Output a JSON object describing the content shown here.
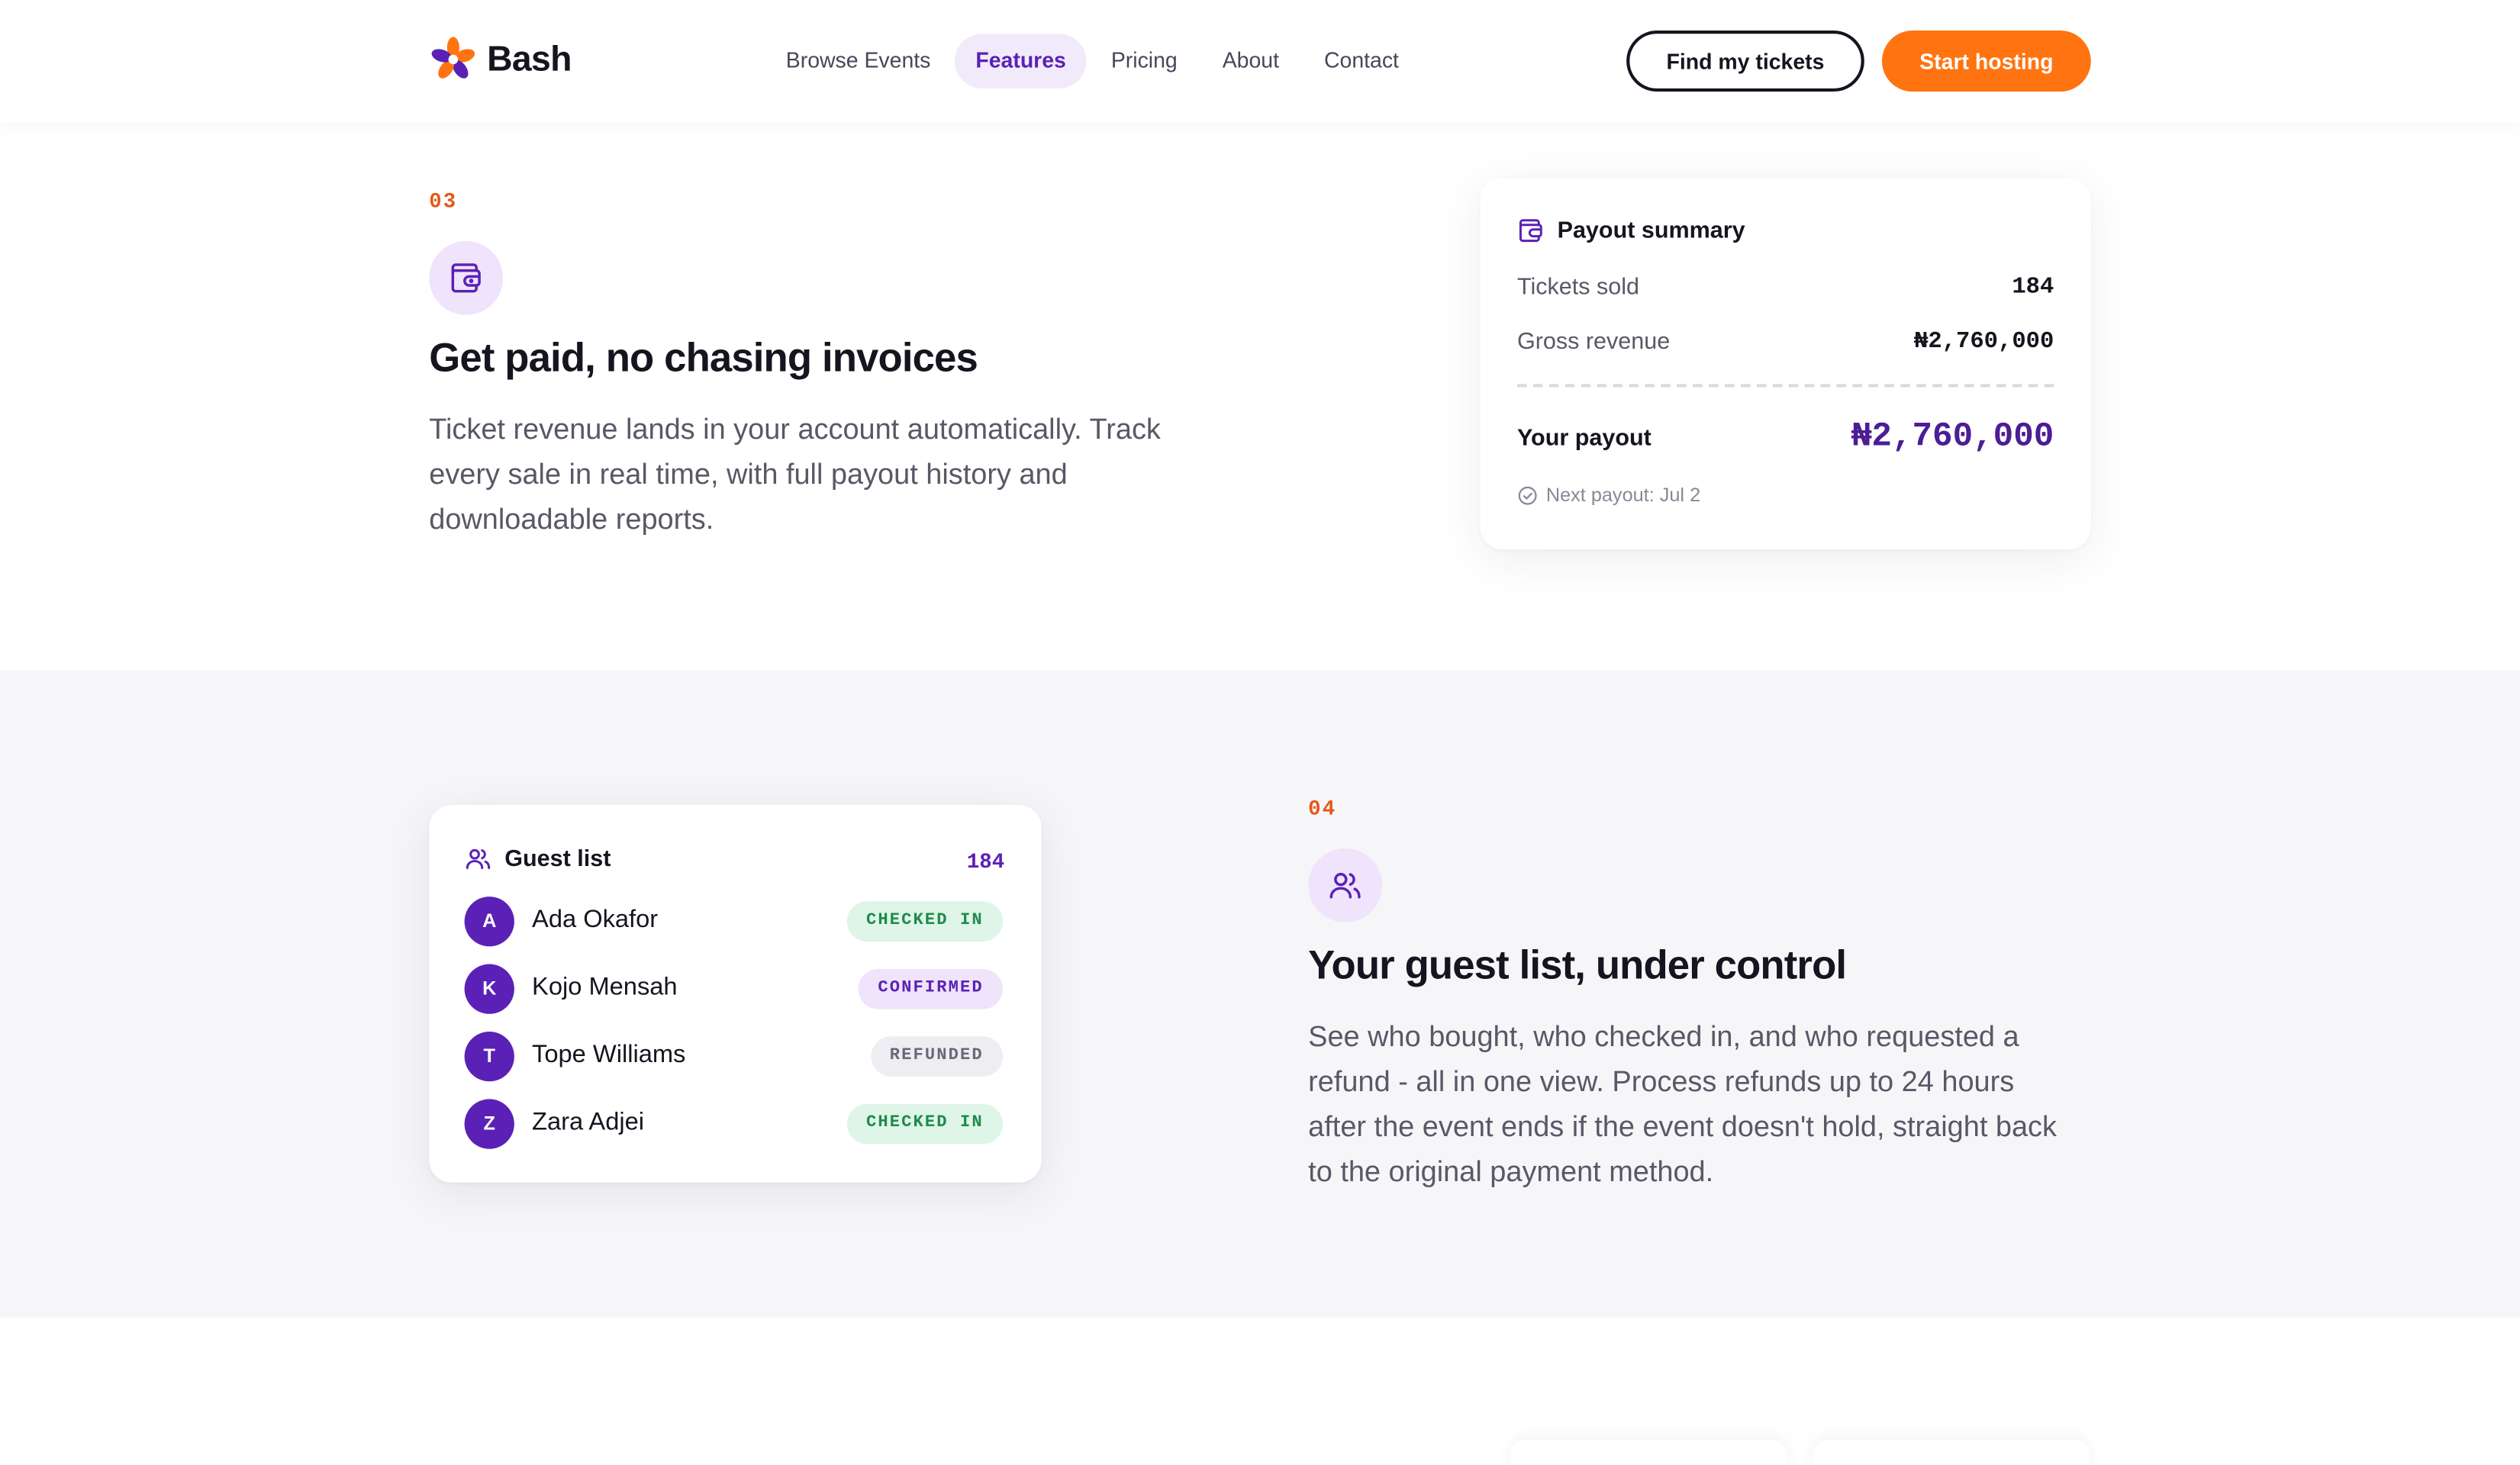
{
  "brand": {
    "name": "Bash",
    "colors": {
      "accent": "#5b21b6",
      "cta": "#ff7410",
      "section_number": "#e4591b"
    }
  },
  "nav": {
    "links": [
      {
        "label": "Browse Events",
        "active": false
      },
      {
        "label": "Features",
        "active": true
      },
      {
        "label": "Pricing",
        "active": false
      },
      {
        "label": "About",
        "active": false
      },
      {
        "label": "Contact",
        "active": false
      }
    ],
    "find_tickets_label": "Find my tickets",
    "start_hosting_label": "Start hosting"
  },
  "feature_payouts": {
    "number": "03",
    "icon": "wallet-icon",
    "title": "Get paid, no chasing invoices",
    "description": "Ticket revenue lands in your account automatically. Track every sale in real time, with full payout history and downloadable reports.",
    "card": {
      "title": "Payout summary",
      "icon": "wallet-icon",
      "rows": [
        {
          "label": "Tickets sold",
          "value": "184"
        },
        {
          "label": "Gross revenue",
          "value": "₦2,760,000"
        }
      ],
      "total_label": "Your payout",
      "total_value": "₦2,760,000",
      "next_payout": "Next payout: Jul 2"
    }
  },
  "feature_guests": {
    "number": "04",
    "icon": "users-icon",
    "title": "Your guest list, under control",
    "description": "See who bought, who checked in, and who requested a refund - all in one view. Process refunds up to 24 hours after the event ends if the event doesn't hold, straight back to the original payment method.",
    "card": {
      "title": "Guest list",
      "icon": "users-icon",
      "count": "184",
      "guests": [
        {
          "initial": "A",
          "name": "Ada Okafor",
          "status": "CHECKED IN",
          "status_kind": "checked"
        },
        {
          "initial": "K",
          "name": "Kojo Mensah",
          "status": "CONFIRMED",
          "status_kind": "confirmed"
        },
        {
          "initial": "T",
          "name": "Tope Williams",
          "status": "REFUNDED",
          "status_kind": "refunded"
        },
        {
          "initial": "Z",
          "name": "Zara Adjei",
          "status": "CHECKED IN",
          "status_kind": "checked"
        }
      ]
    }
  }
}
